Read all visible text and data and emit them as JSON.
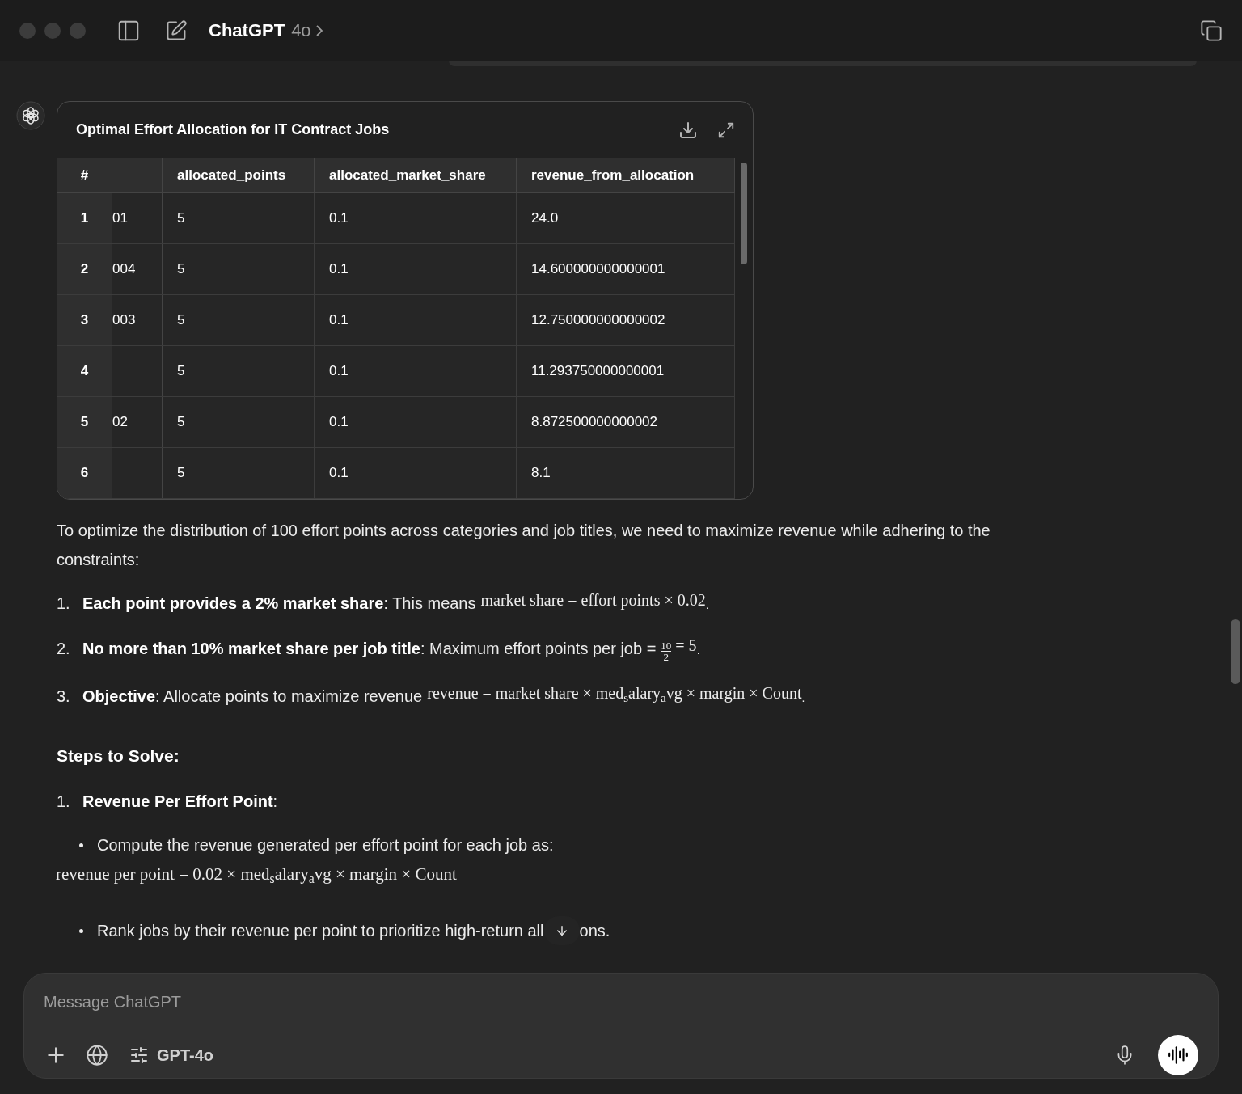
{
  "window": {
    "title": "ChatGPT",
    "model": "4o"
  },
  "table_card": {
    "title": "Optimal Effort Allocation for IT Contract Jobs",
    "columns": [
      "#",
      "allocated_points",
      "allocated_market_share",
      "revenue_from_allocation"
    ],
    "rows": [
      {
        "index": "1",
        "column_2": "01",
        "allocated_points": "5",
        "allocated_market_share": "0.1",
        "revenue_from_allocation": "24.0"
      },
      {
        "index": "2",
        "column_2": "004",
        "allocated_points": "5",
        "allocated_market_share": "0.1",
        "revenue_from_allocation": "14.600000000000001"
      },
      {
        "index": "3",
        "column_2": "003",
        "allocated_points": "5",
        "allocated_market_share": "0.1",
        "revenue_from_allocation": "12.750000000000002"
      },
      {
        "index": "4",
        "allocated_points": "5",
        "allocated_market_share": "0.1",
        "revenue_from_allocation": "11.293750000000001"
      },
      {
        "index": "5",
        "column_2": "02",
        "allocated_points": "5",
        "allocated_market_share": "0.1",
        "revenue_from_allocation": "8.872500000000002"
      },
      {
        "index": "6",
        "allocated_points": "5",
        "allocated_market_share": "0.1",
        "revenue_from_allocation": "8.1"
      }
    ]
  },
  "intro": "To optimize the distribution of 100 effort points across categories and job titles, we need to maximize revenue while adhering to the constraints:",
  "constraints": [
    {
      "number": "1.",
      "label": "Each point provides a 2% market share",
      "text": ": This means",
      "math": "market share = effort points × 0.02",
      "end": "."
    },
    {
      "number": "2.",
      "label": "No more than 10% market share per job title",
      "text": ": Maximum effort points per job =",
      "numerator": "10",
      "denominator": "2",
      "math": "= 5",
      "end": "."
    },
    {
      "number": "3.",
      "label": "Objective",
      "text": ": Allocate points to maximize revenue",
      "math": "revenue = market share × med$_{s}$alary$_{a}$vg × margin × Count",
      "end": "."
    }
  ],
  "steps_heading": "Steps to Solve:",
  "steps": [
    {
      "number": "1.",
      "label": "Revenue Per Effort Point",
      "suffix": ":",
      "items": [
        {
          "kind": "bullet",
          "text": "Compute the revenue generated per effort point for each job as:"
        },
        {
          "kind": "math",
          "text": "revenue per point = 0.02 × med$_{s}$alary$_{a}$vg × margin × Count"
        },
        {
          "kind": "bullet",
          "text": "Rank jobs by their revenue per point to prioritize high-return all",
          "after": "ons."
        }
      ]
    }
  ],
  "composer": {
    "placeholder": "Message ChatGPT",
    "model": "GPT-4o"
  }
}
